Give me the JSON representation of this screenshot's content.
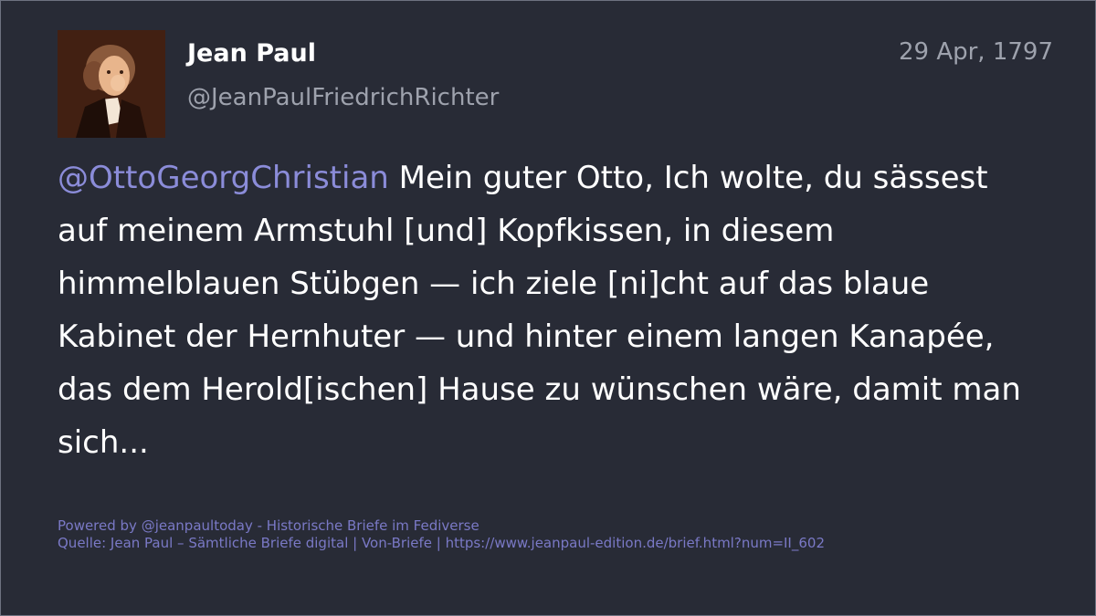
{
  "post": {
    "author_name": "Jean Paul",
    "author_handle": "@JeanPaulFriedrichRichter",
    "date": "29 Apr, 1797",
    "mention": "@OttoGeorgChristian",
    "text": " Mein guter Otto, Ich wolte, du sässest auf meinem Armstuhl [und] Kopfkissen, in diesem himmelblauen Stübgen — ich ziele [ni]cht auf das blaue Kabinet der Hernhuter — und hinter einem langen Kanapée, das dem Herold[ischen] Hause zu wünschen wäre, damit man sich..."
  },
  "footer": {
    "powered_by": "Powered by @jeanpaultoday - Historische Briefe im Fediverse",
    "source": "Quelle: Jean Paul – Sämtliche Briefe digital | Von-Briefe | https://www.jeanpaul-edition.de/brief.html?num=II_602"
  },
  "colors": {
    "background": "#282b36",
    "mention": "#8b8cd9",
    "footer": "#7a79c6",
    "muted": "#9ea2ad"
  }
}
